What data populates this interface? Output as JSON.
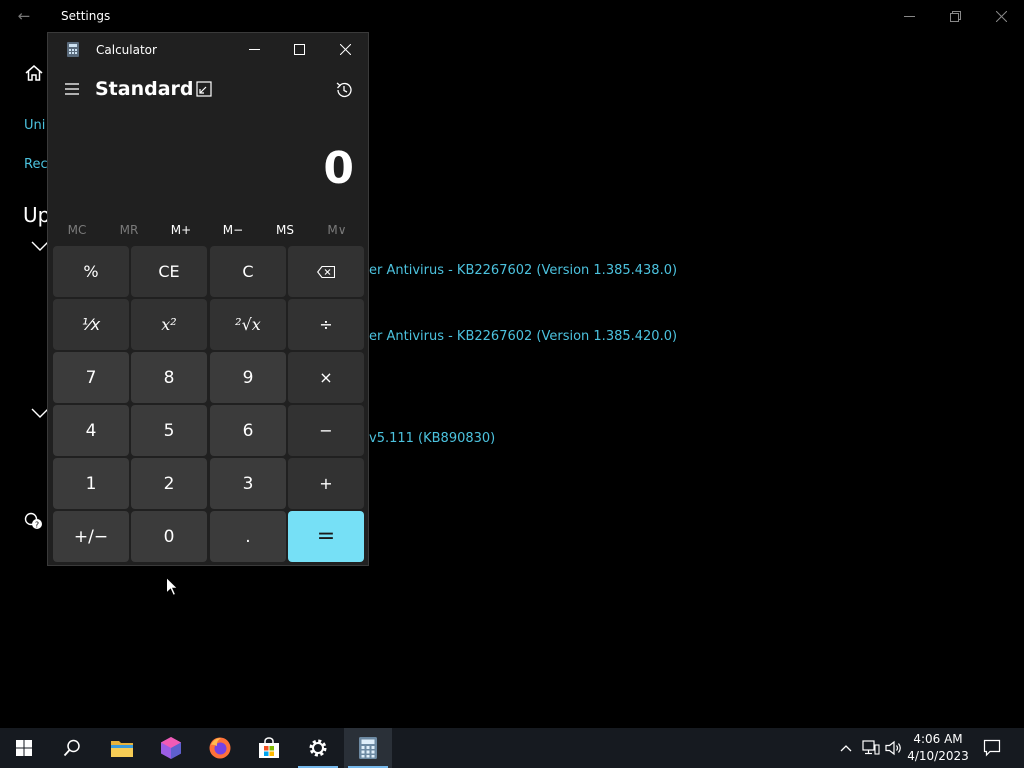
{
  "settings": {
    "title": "Settings",
    "links": [
      "Uni",
      "Rec"
    ],
    "heading": "Up",
    "updates": [
      "er Antivirus - KB2267602 (Version 1.385.438.0)",
      "er Antivirus - KB2267602 (Version 1.385.420.0)",
      "v5.111 (KB890830)"
    ]
  },
  "calculator": {
    "title": "Calculator",
    "mode": "Standard",
    "display": "0",
    "memory": [
      "MC",
      "MR",
      "M+",
      "M−",
      "MS",
      "M∨"
    ],
    "keys": [
      [
        "%",
        "CE",
        "C",
        "⌫"
      ],
      [
        "¹⁄x",
        "x²",
        "²√x",
        "÷"
      ],
      [
        "7",
        "8",
        "9",
        "×"
      ],
      [
        "4",
        "5",
        "6",
        "−"
      ],
      [
        "1",
        "2",
        "3",
        "+"
      ],
      [
        "+/−",
        "0",
        ".",
        "="
      ]
    ],
    "accent": "#76e0f6"
  },
  "taskbar": {
    "apps": [
      "start-icon",
      "search-icon",
      "file-explorer-icon",
      "paint3d-icon",
      "firefox-icon",
      "store-icon",
      "settings-icon",
      "calculator-icon"
    ],
    "clock_time": "4:06 AM",
    "clock_date": "4/10/2023"
  }
}
